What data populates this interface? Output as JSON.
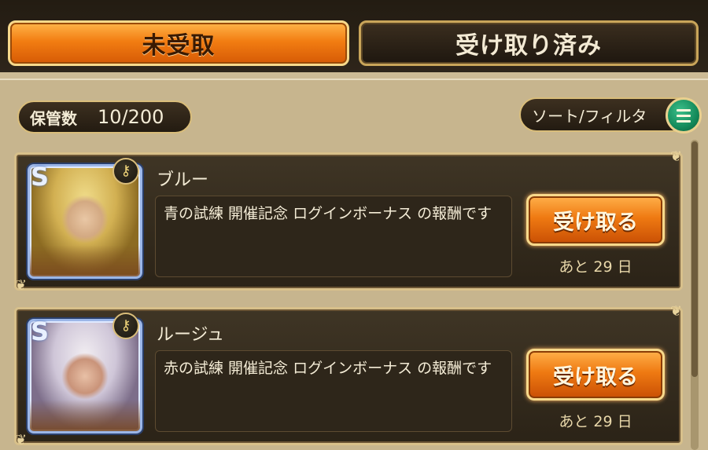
{
  "tabs": [
    {
      "label": "未受取",
      "active": true
    },
    {
      "label": "受け取り済み",
      "active": false
    }
  ],
  "storage": {
    "label": "保管数",
    "value": "10/200"
  },
  "sort_filter": {
    "label": "ソート/フィルタ",
    "icon": "menu-icon"
  },
  "rewards": [
    {
      "name": "ブルー",
      "description": "青の試練 開催記念 ログインボーナス の報酬です",
      "button_label": "受け取る",
      "remaining": "あと 29 日"
    },
    {
      "name": "ルージュ",
      "description": "赤の試練 開催記念 ログインボーナス の報酬です",
      "button_label": "受け取る",
      "remaining": "あと 29 日"
    }
  ],
  "colors": {
    "accent_orange": "#ef7a12",
    "gold_border": "#d8c08a",
    "card_bg": "#2b2317",
    "menu_green": "#138a5a"
  }
}
